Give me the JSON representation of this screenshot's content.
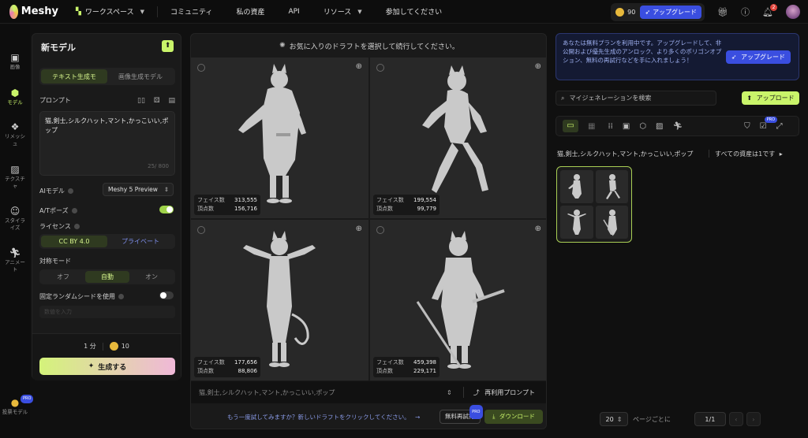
{
  "topbar": {
    "brand": "Meshy",
    "nav": [
      "ワークスペース",
      "コミュニティ",
      "私の資産",
      "API",
      "リソース",
      "参加してください"
    ],
    "credits": "90",
    "upgrade_label": "アップグレード",
    "notif_count": "2"
  },
  "rail": [
    {
      "label": "画像",
      "icon": "image-icon"
    },
    {
      "label": "モデル",
      "icon": "cube-icon"
    },
    {
      "label": "リメッシュ",
      "icon": "remesh-icon"
    },
    {
      "label": "テクスチャ",
      "icon": "texture-icon"
    },
    {
      "label": "スタイライズ",
      "icon": "stylize-icon"
    },
    {
      "label": "アニメート",
      "icon": "animate-icon"
    },
    {
      "label": "投票モデル",
      "icon": "vote-icon",
      "badge": "PRO"
    }
  ],
  "left": {
    "title": "新モデル",
    "tabs": [
      "テキスト生成モ",
      "画像生成モデル"
    ],
    "prompt_label": "プロンプト",
    "prompt_text": "猫,剣士,シルクハット,マント,かっこいい,ポップ",
    "prompt_count": "25/ 800",
    "ai_model_label": "AIモデル",
    "ai_model_value": "Meshy 5 Preview",
    "atpose_label": "A/Tポーズ",
    "license_label": "ライセンス",
    "license_options": [
      "CC BY 4.0",
      "プライベート"
    ],
    "symmetry_label": "対称モード",
    "symmetry_options": [
      "オフ",
      "自動",
      "オン"
    ],
    "seed_label": "固定ランダムシードを使用",
    "seed_placeholder": "数値を入力",
    "time": "1 分",
    "cost": "10",
    "generate_label": "生成する"
  },
  "center": {
    "header": "お気に入りのドラフトを選択して続行してください。",
    "face_label": "フェイス数",
    "vertex_label": "頂点数",
    "drafts": [
      {
        "faces": "313,555",
        "vertices": "156,716"
      },
      {
        "faces": "199,554",
        "vertices": "99,779"
      },
      {
        "faces": "177,656",
        "vertices": "88,806"
      },
      {
        "faces": "459,398",
        "vertices": "229,171"
      }
    ],
    "prompt_text": "猫,剣士,シルクハット,マント,かっこいい,ポップ",
    "reuse_label": "再利用プロンプト",
    "hint": "もう一度試してみますか？新しいドラフトをクリックしてください。",
    "retry_label": "無料再試行",
    "retry_badge": "PRO",
    "download_label": "ダウンロード"
  },
  "right": {
    "notice": "あなたは無料プランを利用中です。アップグレードして、非公開および優先生成のアンロック、より多くのポリゴンオプション、無料の再試行などを手に入れましょう！",
    "notice_btn": "アップグレード",
    "search_placeholder": "マイジェネレーションを検索",
    "upload_label": "アップロード",
    "toolbar_badge": "PRO",
    "group_title": "猫,剣士,シルクハット,マント,かっこいい,ポップ",
    "group_right": "すべての資産は1です",
    "page_size": "20",
    "per_page_label": "ページごとに",
    "page_indicator": "1/1"
  },
  "colors": {
    "accent": "#c9f46a",
    "brand_blue": "#3a4ee0",
    "bg": "#101010"
  }
}
